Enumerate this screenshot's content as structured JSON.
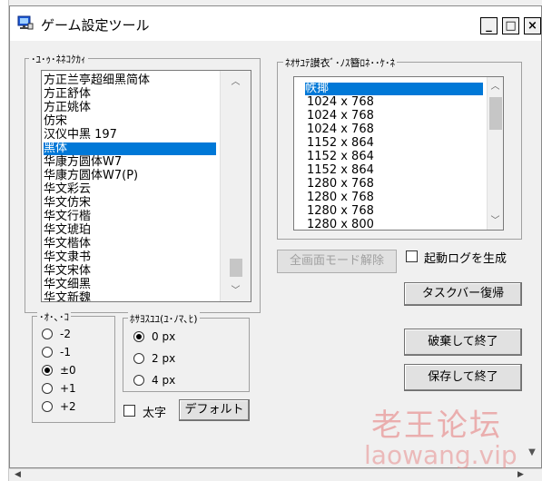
{
  "window": {
    "title": "ゲーム設定ツール",
    "minimize": "_",
    "maximize": "□",
    "close": "×"
  },
  "font_group": {
    "legend": "･ﾕ･ｩ･ﾈﾈｺｸｶｨ",
    "items": [
      "方正兰亭超细黑简体",
      "方正舒体",
      "方正姚体",
      "仿宋",
      "汉仪中黑 197",
      "黑体",
      "华康方圆体W7",
      "华康方圆体W7(P)",
      "华文彩云",
      "华文仿宋",
      "华文行楷",
      "华文琥珀",
      "华文楷体",
      "华文隶书",
      "华文宋体",
      "华文细黑",
      "华文新魏"
    ],
    "selected_index": 5
  },
  "resolution_group": {
    "legend": "ﾈｵｻﾕﾃ讃衣ﾞ･ﾉｽ簪ﾛﾈ･･ｹ･ﾈ",
    "items": [
      "帙揶",
      "1024 x 768",
      "1024 x 768",
      "1024 x 768",
      "1152 x 864",
      "1152 x 864",
      "1152 x 864",
      "1280 x 768",
      "1280 x 768",
      "1280 x 768",
      "1280 x 800"
    ],
    "selected_index": 0
  },
  "size_group": {
    "legend": "･ｵ･､･ｺ",
    "options": [
      "-2",
      "-1",
      "±0",
      "+1",
      "+2"
    ],
    "selected_index": 2
  },
  "shadow_group": {
    "legend": "ﾎｻﾖｽﾕﾕ(ﾕ･ﾉﾏ､ﾋ)",
    "options": [
      "0 px",
      "2 px",
      "4 px"
    ],
    "selected_index": 0
  },
  "bold": {
    "label": "太字",
    "checked": false
  },
  "default_button": "デフォルト",
  "fullscreen_button": "全画面モード解除",
  "log_checkbox": {
    "label": "起動ログを生成",
    "checked": false
  },
  "taskbar_button": "タスクバー復帰",
  "discard_button": "破棄して終了",
  "save_button": "保存して終了",
  "watermark": {
    "line1": "老王论坛",
    "line2": "laowang.vip"
  }
}
